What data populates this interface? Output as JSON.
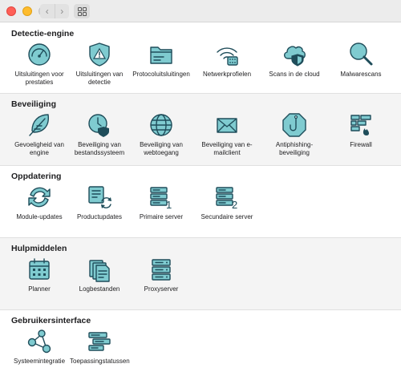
{
  "window": {
    "back_glyph": "‹",
    "forward_glyph": "›"
  },
  "sections": [
    {
      "title": "Detectie-engine",
      "items": [
        {
          "label": "Uitsluitingen voor prestaties",
          "icon": "gauge-icon"
        },
        {
          "label": "Uitsluitingen van detectie",
          "icon": "warning-shield-icon"
        },
        {
          "label": "Protocoluitsluitingen",
          "icon": "folder-icon"
        },
        {
          "label": "Netwerkprofielen",
          "icon": "wifi-icon"
        },
        {
          "label": "Scans in de cloud",
          "icon": "cloud-shield-icon"
        },
        {
          "label": "Malwarescans",
          "icon": "magnifier-icon"
        }
      ]
    },
    {
      "title": "Beveiliging",
      "items": [
        {
          "label": "Gevoeligheid van engine",
          "icon": "feather-icon"
        },
        {
          "label": "Beveiliging van bestandssysteem",
          "icon": "file-shield-icon"
        },
        {
          "label": "Beveiliging van webtoegang",
          "icon": "globe-icon"
        },
        {
          "label": "Beveiliging van e-mailclient",
          "icon": "envelope-icon"
        },
        {
          "label": "Antiphishing-beveiliging",
          "icon": "hook-icon"
        },
        {
          "label": "Firewall",
          "icon": "firewall-icon"
        }
      ]
    },
    {
      "title": "Oppdatering",
      "items": [
        {
          "label": "Module-updates",
          "icon": "refresh-icon"
        },
        {
          "label": "Productupdates",
          "icon": "product-update-icon"
        },
        {
          "label": "Primaire server",
          "icon": "server-1-icon"
        },
        {
          "label": "Secundaire server",
          "icon": "server-2-icon"
        }
      ]
    },
    {
      "title": "Hulpmiddelen",
      "items": [
        {
          "label": "Planner",
          "icon": "calendar-icon"
        },
        {
          "label": "Logbestanden",
          "icon": "documents-icon"
        },
        {
          "label": "Proxyserver",
          "icon": "proxy-server-icon"
        }
      ]
    },
    {
      "title": "Gebruikersinterface",
      "items": [
        {
          "label": "Systeemintegratie",
          "icon": "network-nodes-icon"
        },
        {
          "label": "Toepassingstatussen",
          "icon": "status-bars-icon"
        }
      ]
    }
  ],
  "server_numbers": {
    "primary": "1",
    "secondary": "2"
  },
  "colors": {
    "icon_fill": "#7fcbd0",
    "icon_stroke": "#1f4d5a",
    "alt_band": "#f4f4f4"
  }
}
